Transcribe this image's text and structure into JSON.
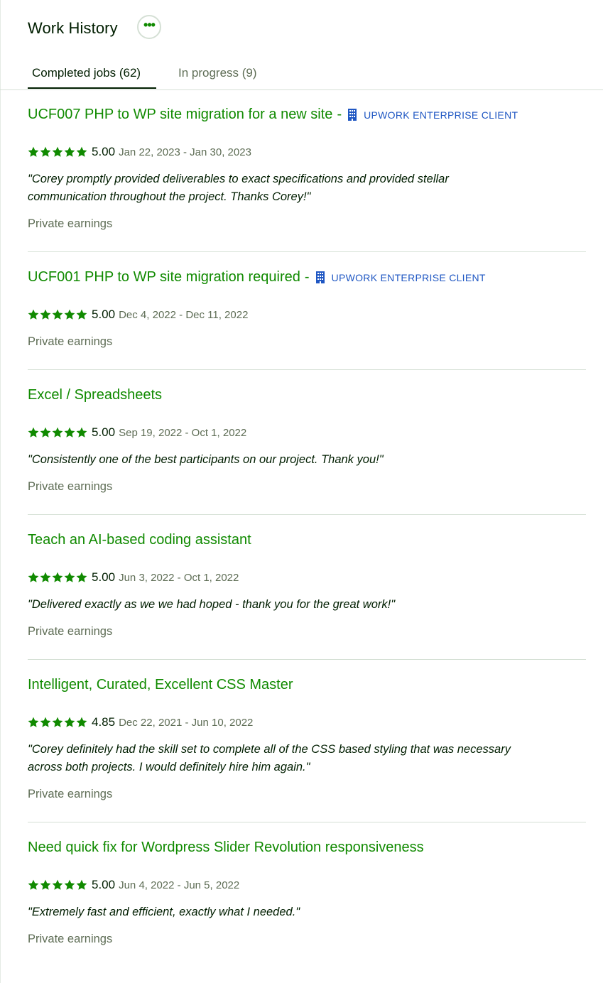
{
  "header": {
    "title": "Work History",
    "more_icon": "ellipsis-icon"
  },
  "tabs": [
    {
      "label": "Completed jobs (62)",
      "active": true
    },
    {
      "label": "In progress (9)",
      "active": false
    }
  ],
  "colors": {
    "accent": "#108a00",
    "enterprise": "#1f57c3",
    "text": "#001e00",
    "muted": "#5e6d55",
    "divider": "#d5e0d5"
  },
  "jobs": [
    {
      "title": "UCF007 PHP to WP site migration for a new site",
      "enterprise_label": "UPWORK ENTERPRISE CLIENT",
      "stars": 5,
      "score": "5.00",
      "dates": "Jan 22, 2023 - Jan 30, 2023",
      "review_line1": "\"Corey promptly provided deliverables to exact specifications and provided stellar",
      "review_line2": "communication throughout the project. Thanks Corey!\"",
      "earnings": "Private earnings"
    },
    {
      "title": "UCF001 PHP to WP site migration required",
      "enterprise_label": "UPWORK ENTERPRISE CLIENT",
      "stars": 5,
      "score": "5.00",
      "dates": "Dec 4, 2022 - Dec 11, 2022",
      "earnings": "Private earnings"
    },
    {
      "title": "Excel / Spreadsheets",
      "stars": 5,
      "score": "5.00",
      "dates": "Sep 19, 2022 - Oct 1, 2022",
      "review_line1": "\"Consistently one of the best participants on our project. Thank you!\"",
      "earnings": "Private earnings"
    },
    {
      "title": "Teach an AI-based coding assistant",
      "stars": 5,
      "score": "5.00",
      "dates": "Jun 3, 2022 - Oct 1, 2022",
      "review_line1": "\"Delivered exactly as we we had hoped - thank you for the great work!\"",
      "earnings": "Private earnings"
    },
    {
      "title": "Intelligent, Curated, Excellent CSS Master",
      "stars": 5,
      "score": "4.85",
      "dates": "Dec 22, 2021 - Jun 10, 2022",
      "review_line1": "\"Corey definitely had the skill set to complete all of the CSS based styling that was necessary",
      "review_line2": "across both projects. I would definitely hire him again.\"",
      "earnings": "Private earnings"
    },
    {
      "title": "Need quick fix for Wordpress Slider Revolution responsiveness",
      "stars": 5,
      "score": "5.00",
      "dates": "Jun 4, 2022 - Jun 5, 2022",
      "review_line1": "\"Extremely fast and efficient, exactly what I needed.\"",
      "earnings": "Private earnings"
    }
  ]
}
